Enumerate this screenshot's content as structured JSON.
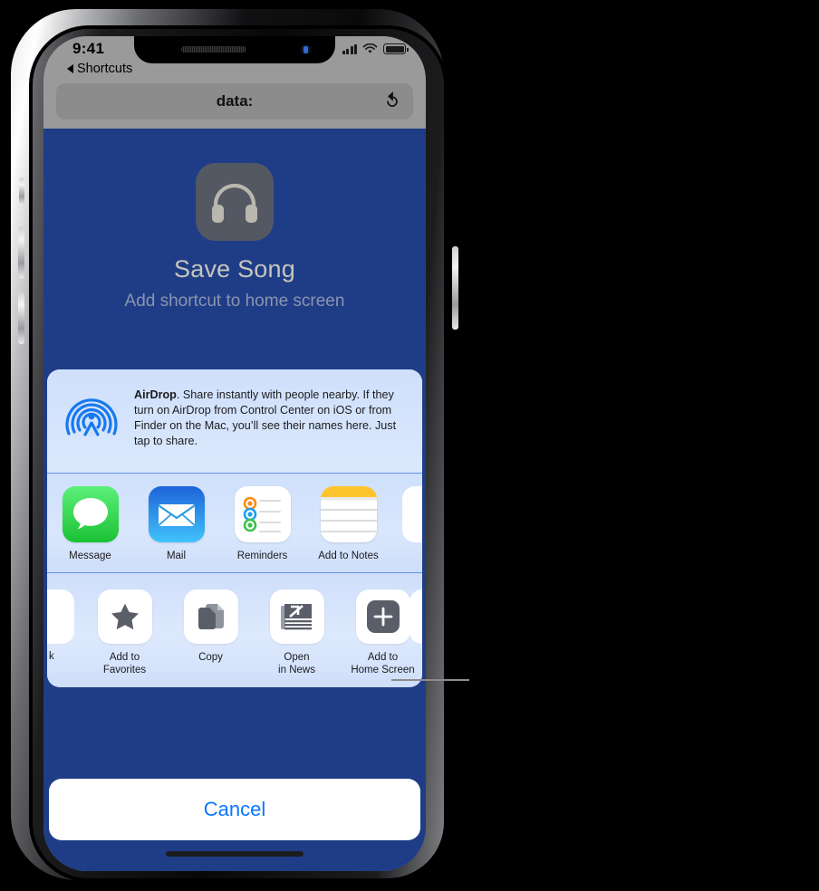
{
  "device": {
    "name": "iPhone X"
  },
  "status_bar": {
    "time": "9:41",
    "signal_icon": "cellular-bars-icon",
    "wifi_icon": "wifi-icon",
    "battery_icon": "battery-icon"
  },
  "browser": {
    "back_label": "Shortcuts",
    "back_icon": "triangle-left-icon",
    "address_value": "data:",
    "reload_icon": "reload-icon"
  },
  "webpage": {
    "app_icon": "headphones-icon",
    "title": "Save Song",
    "subtitle": "Add shortcut to home screen",
    "background_color": "#1f3d87"
  },
  "share_sheet": {
    "airdrop": {
      "icon": "airdrop-icon",
      "title": "AirDrop",
      "body": ". Share instantly with people nearby. If they turn on AirDrop from Control Center on iOS or from Finder on the Mac, you’ll see their names here. Just tap to share."
    },
    "app_row": [
      {
        "label": "Message",
        "icon": "messages-icon"
      },
      {
        "label": "Mail",
        "icon": "mail-icon"
      },
      {
        "label": "Reminders",
        "icon": "reminders-icon"
      },
      {
        "label": "Add to Notes",
        "icon": "notes-icon"
      }
    ],
    "action_row_partial_left_label": "k",
    "action_row": [
      {
        "label": "Add to\nFavorites",
        "icon": "star-icon"
      },
      {
        "label": "Copy",
        "icon": "copy-icon"
      },
      {
        "label": "Open\nin News",
        "icon": "news-icon"
      },
      {
        "label": "Add to\nHome Screen",
        "icon": "plus-square-icon"
      }
    ],
    "cancel_label": "Cancel"
  },
  "colors": {
    "accent_blue": "#0a76ff",
    "page_blue": "#1f3d87",
    "sheet_blue": "#cfe0fb",
    "divider_blue": "#3e7bdd",
    "icon_gray": "#545863"
  }
}
